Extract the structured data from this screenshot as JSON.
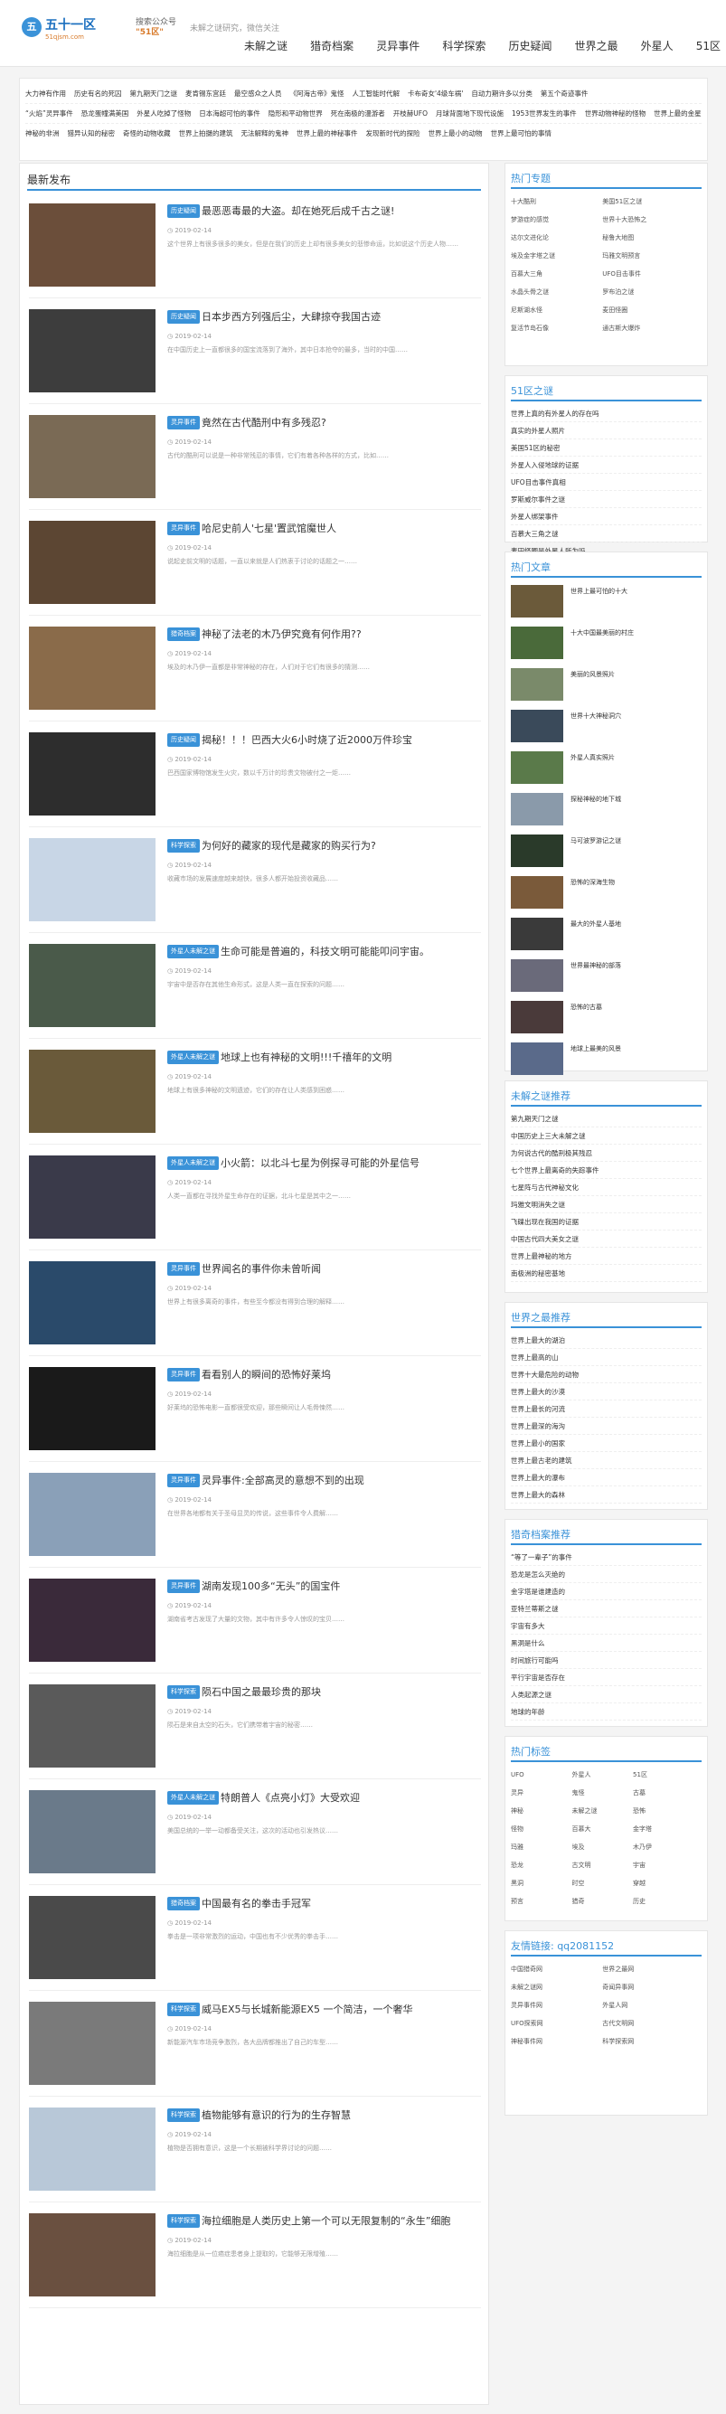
{
  "header": {
    "logo_mark": "五",
    "logo_text": "五十一区",
    "logo_sub": "51qjsm.com",
    "wechat_line1": "搜索公众号",
    "wechat_line2": "\"51区\"",
    "tagline": "未解之谜研究，微信关注"
  },
  "nav": [
    "未解之谜",
    "猎奇档案",
    "灵异事件",
    "科学探索",
    "历史疑闻",
    "世界之最",
    "外星人",
    "51区"
  ],
  "tags": {
    "row1": [
      "大力神有作用",
      "历史有名的死囚",
      "第九期天门之谜",
      "麦肯锡东宫廷",
      "最空感众之人员",
      "《阿海古帝》鬼怪",
      "人工智能时代解",
      "卡布奇女'4级车祸'",
      "自动力期许多以分类",
      "第五个奇迹事件"
    ],
    "row2": [
      "“火焰”灵异事件",
      "恐龙蛋幢满美国",
      "外星人吃掉了怪物",
      "日本海超可怕的事件",
      "隐形和平动物世界",
      "死在南极的漫游者",
      "开枝赫UFO",
      "月球背面地下现代设施",
      "1953世界发生的事件",
      "世界动物神秘的怪物",
      "世界上最的金星世界"
    ],
    "row3": [
      "神秘的非洲",
      "猎异认知的秘密",
      "奇怪的动物收藏",
      "世界上拍摄的建筑",
      "无法解释的鬼神",
      "世界上最的神秘事件",
      "发现新时代的探险",
      "世界上最小的动物",
      "世界上最可怕的事情"
    ]
  },
  "main": {
    "section_title": "最新发布",
    "articles": [
      {
        "cat": "历史疑闻",
        "title": "最恶恶毒最的大盗。却在她死后成千古之谜!",
        "date": "2019-02-14",
        "desc": "这个世界上有很多很多的美女，但是在我们的历史上却有很多美女的悲惨命运，比如说这个历史人物……"
      },
      {
        "cat": "历史疑闻",
        "title": "日本步西方列强后尘，大肆掠夺我国古迹",
        "date": "2019-02-14",
        "desc": "在中国历史上一直都很多的国宝流落到了海外，其中日本抢夺的最多，当时的中国……"
      },
      {
        "cat": "灵异事件",
        "title": "竟然在古代酷刑中有多残忍?",
        "date": "2019-02-14",
        "desc": "古代的酷刑可以说是一种非常残忍的事情，它们有着各种各样的方式，比如……"
      },
      {
        "cat": "灵异事件",
        "title": "哈尼史前人'七星'置武馆魔世人",
        "date": "2019-02-14",
        "desc": "说起史前文明的话题，一直以来就是人们热衷于讨论的话题之一……"
      },
      {
        "cat": "猎奇档案",
        "title": "神秘了法老的木乃伊究竟有何作用??",
        "date": "2019-02-14",
        "desc": "埃及的木乃伊一直都是非常神秘的存在，人们对于它们有很多的猜测……"
      },
      {
        "cat": "历史疑闻",
        "title": "揭秘！！！巴西大火6小时烧了近2000万件珍宝",
        "date": "2019-02-14",
        "desc": "巴西国家博物馆发生火灾，数以千万计的珍贵文物被付之一炬……"
      },
      {
        "cat": "科学探索",
        "title": "为何好的藏家的现代是藏家的购买行为?",
        "date": "2019-02-14",
        "desc": "收藏市场的发展速度越来越快，很多人都开始投资收藏品……"
      },
      {
        "cat": "外星人未解之谜",
        "title": "生命可能是普遍的，科技文明可能能叩问宇宙。",
        "date": "2019-02-14",
        "desc": "宇宙中是否存在其他生命形式，这是人类一直在探索的问题……"
      },
      {
        "cat": "外星人未解之谜",
        "title": "地球上也有神秘的文明!!!千禧年的文明",
        "date": "2019-02-14",
        "desc": "地球上有很多神秘的文明遗迹，它们的存在让人类感到困惑……"
      },
      {
        "cat": "外星人未解之谜",
        "title": "小火箭：以北斗七星为例探寻可能的外星信号",
        "date": "2019-02-14",
        "desc": "人类一直都在寻找外星生命存在的证据，北斗七星是其中之一……"
      },
      {
        "cat": "灵异事件",
        "title": "世界闻名的事件你未曾听闻",
        "date": "2019-02-14",
        "desc": "世界上有很多离奇的事件，有些至今都没有得到合理的解释……"
      },
      {
        "cat": "灵异事件",
        "title": "看看别人的瞬间的恐怖好莱坞",
        "date": "2019-02-14",
        "desc": "好莱坞的恐怖电影一直都很受欢迎，那些瞬间让人毛骨悚然……"
      },
      {
        "cat": "灵异事件",
        "title": "灵异事件:全部高灵的意想不到的出现",
        "date": "2019-02-14",
        "desc": "在世界各地都有关于圣母显灵的传说，这些事件令人费解……"
      },
      {
        "cat": "灵异事件",
        "title": "湖南发现100多“无头”的国宝件",
        "date": "2019-02-14",
        "desc": "湖南省考古发现了大量的文物，其中有许多令人惊叹的宝贝……"
      },
      {
        "cat": "科学探索",
        "title": "陨石中国之最最珍贵的那块",
        "date": "2019-02-14",
        "desc": "陨石是来自太空的石头，它们携带着宇宙的秘密……"
      },
      {
        "cat": "外星人未解之谜",
        "title": "特朗普人《点亮小灯》大受欢迎",
        "date": "2019-02-14",
        "desc": "美国总统的一举一动都备受关注，这次的活动也引发热议……"
      },
      {
        "cat": "猎奇档案",
        "title": "中国最有名的拳击手冠军",
        "date": "2019-02-14",
        "desc": "拳击是一项非常激烈的运动，中国也有不少优秀的拳击手……"
      },
      {
        "cat": "科学探索",
        "title": "威马EX5与长城新能源EX5 一个简洁，一个奢华",
        "date": "2019-02-14",
        "desc": "新能源汽车市场竞争激烈，各大品牌都推出了自己的车型……"
      },
      {
        "cat": "科学探索",
        "title": "植物能够有意识的行为的生存智慧",
        "date": "2019-02-14",
        "desc": "植物是否拥有意识，这是一个长期被科学界讨论的问题……"
      },
      {
        "cat": "科学探索",
        "title": "海拉细胞是人类历史上第一个可以无限复制的“永生”细胞",
        "date": "2019-02-14",
        "desc": "海拉细胞是从一位癌症患者身上提取的，它能够无限增殖……"
      }
    ]
  },
  "side": {
    "hot_tags_title": "热门专题",
    "hot_tags": [
      "十大酷刑",
      "美国51区之谜",
      "梦游症的感觉",
      "世界十大恐怖之",
      "达尔文进化论",
      "秘鲁大地图",
      "埃及金字塔之谜",
      "玛雅文明预言",
      "百慕大三角",
      "UFO目击事件",
      "水晶头骨之谜",
      "罗布泊之谜",
      "尼斯湖水怪",
      "麦田怪圈",
      "复活节岛石像",
      "通古斯大爆炸"
    ],
    "rank_title": "51区之谜",
    "rank": [
      "世界上真的有外星人的存在吗",
      "真实的外星人照片",
      "美国51区的秘密",
      "外星人入侵地球的证据",
      "UFO目击事件真相",
      "罗斯威尔事件之谜",
      "外星人绑架事件",
      "百慕大三角之谜",
      "麦田怪圈是外星人所为吗",
      "玛雅文明与外星人"
    ],
    "hot_article_title": "热门文章",
    "hot_articles": [
      "世界上最可怕的十大",
      "十大中国最美丽的村庄",
      "美丽的风景照片",
      "世界十大神秘洞穴",
      "外星人真实照片",
      "探秘神秘的地下城",
      "马可波罗游记之谜",
      "恐怖的深海生物",
      "最大的外星人基地",
      "世界最神秘的部落",
      "恐怖的古墓",
      "地球上最美的风景"
    ],
    "recommend_title": "未解之谜推荐",
    "recommend": [
      "第九期天门之谜",
      "中国历史上三大未解之谜",
      "为何说古代的酷刑极其残忍",
      "七个世界上最离奇的失踪事件",
      "七星阵与古代神秘文化",
      "玛雅文明消失之谜",
      "飞碟出现在我国的证据",
      "中国古代四大美女之谜",
      "世界上最神秘的地方",
      "南极洲的秘密基地"
    ],
    "world_best_title": "世界之最推荐",
    "world_best": [
      "世界上最大的湖泊",
      "世界上最高的山",
      "世界十大最危险的动物",
      "世界上最大的沙漠",
      "世界上最长的河流",
      "世界上最深的海沟",
      "世界上最小的国家",
      "世界上最古老的建筑",
      "世界上最大的瀑布",
      "世界上最大的森林"
    ],
    "site_rec_title": "猎奇档案推荐",
    "site_rec": [
      "“等了一辈子”的事件",
      "恐龙是怎么灭绝的",
      "金字塔是谁建造的",
      "亚特兰蒂斯之谜",
      "宇宙有多大",
      "黑洞是什么",
      "时间旅行可能吗",
      "平行宇宙是否存在",
      "人类起源之谜",
      "地球的年龄"
    ],
    "cloud_title": "热门标签",
    "cloud": [
      "UFO",
      "外星人",
      "51区",
      "灵异",
      "鬼怪",
      "古墓",
      "神秘",
      "未解之谜",
      "恐怖",
      "怪物",
      "百慕大",
      "金字塔",
      "玛雅",
      "埃及",
      "木乃伊",
      "恐龙",
      "古文明",
      "宇宙",
      "黑洞",
      "时空",
      "穿越",
      "预言",
      "猎奇",
      "历史"
    ],
    "links_title": "友情链接: qq2081152",
    "links": [
      "中国猎奇网",
      "世界之最网",
      "未解之谜网",
      "奇闻异事网",
      "灵异事件网",
      "外星人网",
      "UFO探索网",
      "古代文明网",
      "神秘事件网",
      "科学探索网"
    ]
  }
}
